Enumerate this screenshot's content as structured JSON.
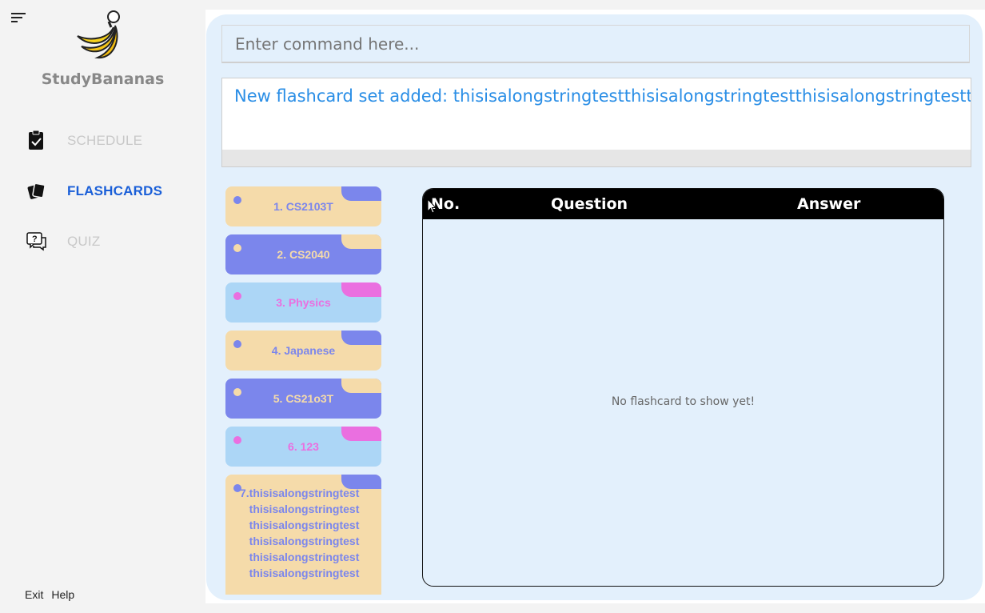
{
  "sidebar": {
    "app_name": "StudyBananas",
    "items": [
      {
        "label": "SCHEDULE",
        "icon": "clipboard-check-icon",
        "active": false
      },
      {
        "label": "FLASHCARDS",
        "icon": "flashcards-icon",
        "active": true
      },
      {
        "label": "QUIZ",
        "icon": "quiz-chat-icon",
        "active": false
      }
    ],
    "footer": {
      "exit": "Exit",
      "help": "Help"
    }
  },
  "command": {
    "placeholder": "Enter command here..."
  },
  "result": {
    "text": "New flashcard set added: thisisalongstringtestthisisalongstringtestthisisalongstringtestth"
  },
  "decks": [
    {
      "label": "1. CS2103T"
    },
    {
      "label": "2. CS2040"
    },
    {
      "label": "3. Physics"
    },
    {
      "label": "4. Japanese"
    },
    {
      "label": "5. CS21o3T"
    },
    {
      "label": "6. 123"
    },
    {
      "label": "7.thisisalongstringtest\n   thisisalongstringtest\n   thisisalongstringtest\n   thisisalongstringtest\n   thisisalongstringtest\n   thisisalongstringtest"
    }
  ],
  "table": {
    "headers": {
      "no": "No.",
      "question": "Question",
      "answer": "Answer"
    },
    "empty_message": "No flashcard to show yet!"
  },
  "colors": {
    "peach": "#f5dbaa",
    "periwinkle": "#7b86ec",
    "lightblue": "#acd6f6",
    "pink": "#ea6fe0",
    "active_nav": "#1a5fd8"
  }
}
